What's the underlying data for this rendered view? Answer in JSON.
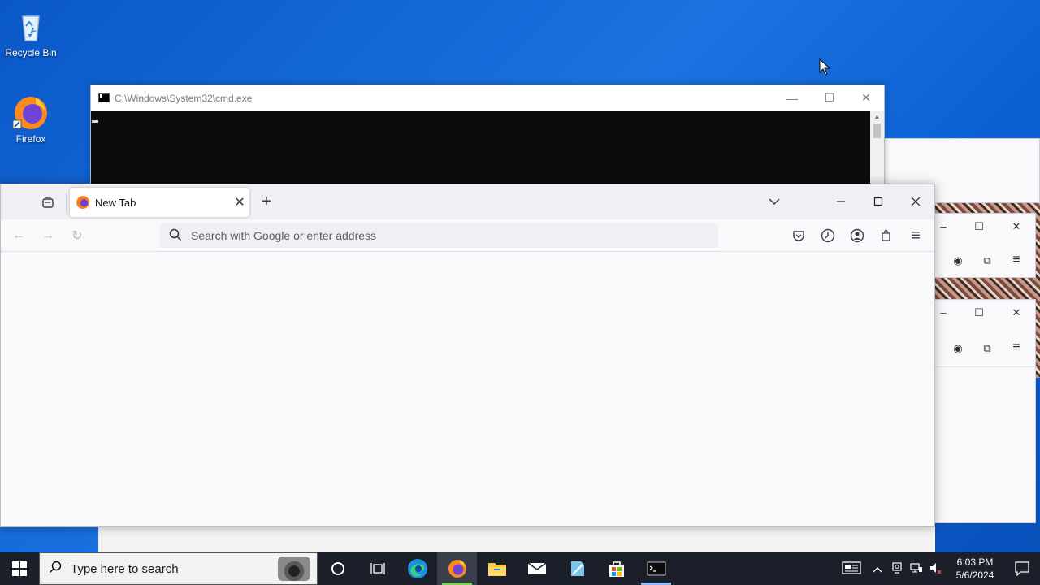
{
  "desktop": {
    "icons": [
      {
        "label": "Recycle Bin",
        "icon": "recycle-bin-icon"
      },
      {
        "label": "Firefox",
        "icon": "firefox-icon"
      }
    ]
  },
  "cmd_window": {
    "title": "C:\\Windows\\System32\\cmd.exe",
    "minimize": "—",
    "maximize": "☐",
    "close": "✕"
  },
  "firefox": {
    "tab_title": "New Tab",
    "tab_close": "✕",
    "new_tab": "+",
    "list_tabs": "⌄",
    "minimize": "—",
    "maximize": "☐",
    "close": "✕",
    "back": "←",
    "forward": "→",
    "reload": "↻",
    "url_placeholder": "Search with Google or enter address",
    "menu": "≡"
  },
  "back_windows": {
    "minimize": "–",
    "maximize": "☐",
    "close": "✕",
    "menu": "≡"
  },
  "taskbar": {
    "search_placeholder": "Type here to search",
    "apps": [
      "cortana",
      "task-view",
      "edge",
      "firefox",
      "file-explorer",
      "mail",
      "notepad",
      "store",
      "terminal"
    ],
    "clock_time": "6:03 PM",
    "clock_date": "5/6/2024"
  },
  "colors": {
    "desktop_blue": "#0b5fd3",
    "taskbar": "#1b1f2a",
    "firefox_chrome": "#f0f0f4",
    "cmd_bg": "#0c0c0c"
  }
}
